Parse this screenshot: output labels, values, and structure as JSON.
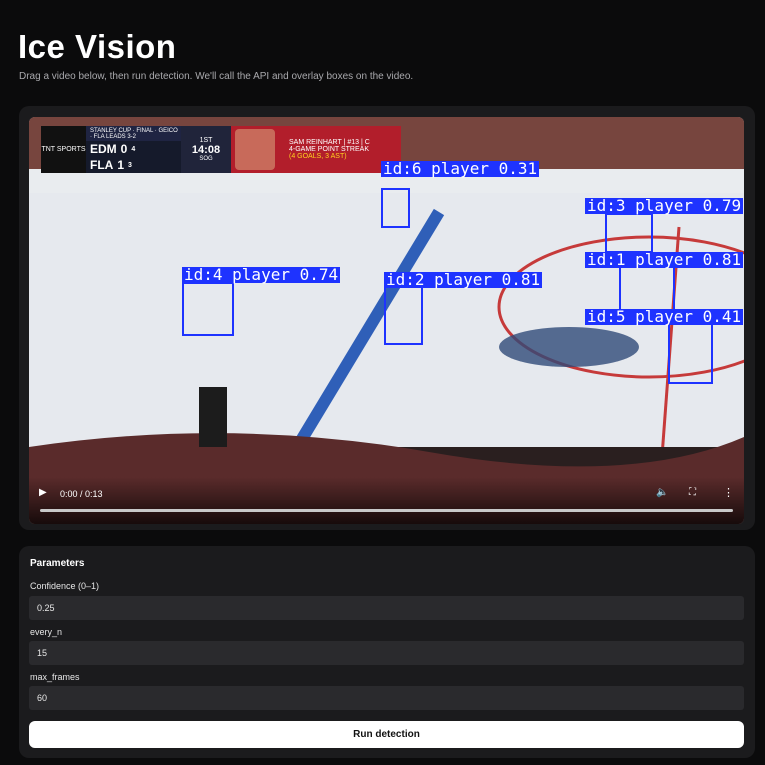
{
  "header": {
    "title": "Ice Vision",
    "subtitle": "Drag a video below, then run detection. We'll call the API and overlay boxes on the video."
  },
  "video": {
    "scorebug": {
      "network": "TNT SPORTS",
      "series_head": "STANLEY CUP · FINAL · GEICO · FLA LEADS 3-2",
      "team1": "EDM",
      "team1_score": "0",
      "team1_sog": "4",
      "team2": "FLA",
      "team2_score": "1",
      "team2_sog": "3",
      "sog_label": "SOG",
      "period": "1ST",
      "clock": "14:08",
      "player_line": "SAM REINHART | #13 | C",
      "streak_line": "4-GAME POINT STREAK",
      "streak_detail": "(4 GOALS, 3 AST)"
    },
    "detections": [
      {
        "label": "id:6  player 0.31"
      },
      {
        "label": "id:3  player 0.79"
      },
      {
        "label": "id:1  player 0.81"
      },
      {
        "label": "id:4  player 0.74"
      },
      {
        "label": "id:2  player 0.81"
      },
      {
        "label": "id:5  player 0.41"
      }
    ],
    "time_display": "0:00 / 0:13",
    "progress": 0
  },
  "params": {
    "title": "Parameters",
    "confidence_label": "Confidence (0–1)",
    "confidence_value": "0.25",
    "every_n_label": "every_n",
    "every_n_value": "15",
    "max_frames_label": "max_frames",
    "max_frames_value": "60",
    "run_label": "Run detection"
  },
  "colors": {
    "bbox": "#1e33ff",
    "background": "#0b0b0c",
    "card": "#1b1b1d",
    "input": "#2a2a2d"
  }
}
